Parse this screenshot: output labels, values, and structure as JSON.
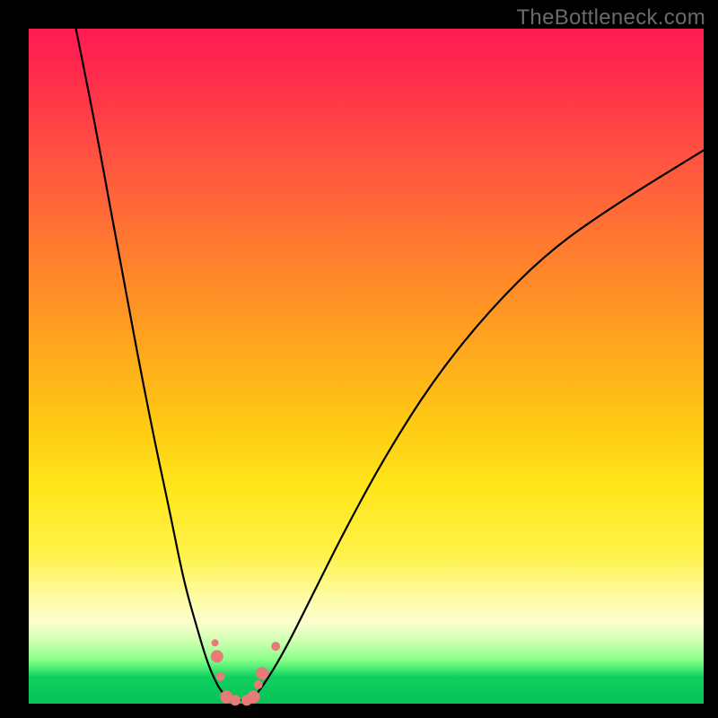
{
  "watermark": "TheBottleneck.com",
  "colors": {
    "frame": "#000000",
    "marker": "#e77b78",
    "curve": "#000000"
  },
  "chart_data": {
    "type": "line",
    "title": "",
    "xlabel": "",
    "ylabel": "",
    "xlim": [
      0,
      100
    ],
    "ylim": [
      0,
      100
    ],
    "series": [
      {
        "name": "left-curve",
        "x": [
          7,
          10,
          14,
          18,
          21,
          23,
          25,
          26.5,
          27.8,
          28.8,
          29.8
        ],
        "y": [
          100,
          85,
          63,
          42,
          28,
          18,
          11,
          6,
          3,
          1.5,
          0.5
        ]
      },
      {
        "name": "valley-floor",
        "x": [
          29.8,
          33.0
        ],
        "y": [
          0.5,
          0.5
        ]
      },
      {
        "name": "right-curve",
        "x": [
          33,
          35,
          38,
          42,
          47,
          53,
          60,
          68,
          77,
          87,
          100
        ],
        "y": [
          0.5,
          3,
          8,
          16,
          26,
          37,
          48,
          58,
          67,
          74,
          82
        ]
      }
    ],
    "markers": {
      "name": "highlight-dots",
      "points": [
        {
          "x": 27.6,
          "y": 9.0,
          "r": 4
        },
        {
          "x": 27.9,
          "y": 7.0,
          "r": 7
        },
        {
          "x": 28.4,
          "y": 4.0,
          "r": 5
        },
        {
          "x": 29.3,
          "y": 1.0,
          "r": 7
        },
        {
          "x": 30.6,
          "y": 0.5,
          "r": 6
        },
        {
          "x": 32.3,
          "y": 0.5,
          "r": 6
        },
        {
          "x": 33.3,
          "y": 1.0,
          "r": 7
        },
        {
          "x": 34.0,
          "y": 2.8,
          "r": 5
        },
        {
          "x": 34.6,
          "y": 4.5,
          "r": 7
        },
        {
          "x": 36.6,
          "y": 8.5,
          "r": 5
        }
      ]
    }
  }
}
